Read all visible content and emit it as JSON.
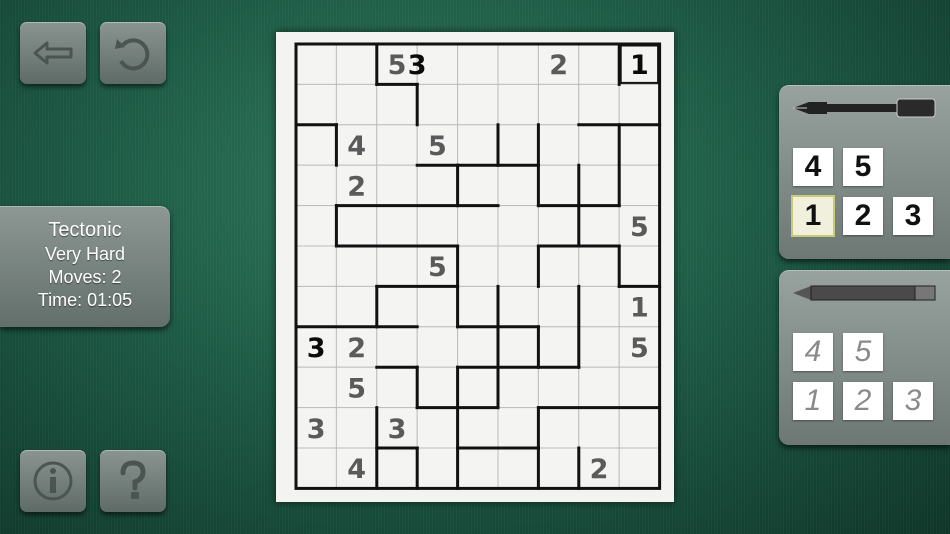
{
  "game": {
    "name": "Tectonic",
    "difficulty": "Very Hard",
    "moves": "Moves: 2",
    "time": "Time: 01:05"
  },
  "toolbar": {
    "back_icon": "back-arrow-icon",
    "undo_icon": "undo-icon",
    "info_icon": "info-icon",
    "help_icon": "help-question-icon"
  },
  "pen_keys": [
    "4",
    "5",
    "1",
    "2",
    "3"
  ],
  "pen_selected": "1",
  "pencil_keys": [
    "4",
    "5",
    "1",
    "2",
    "3"
  ],
  "board": {
    "cols": 9,
    "rows": 11,
    "givens": [
      {
        "r": 0,
        "c": 2,
        "v": "5"
      },
      {
        "r": 0,
        "c": 6,
        "v": "2"
      },
      {
        "r": 2,
        "c": 1,
        "v": "4"
      },
      {
        "r": 2,
        "c": 3,
        "v": "5"
      },
      {
        "r": 3,
        "c": 1,
        "v": "2"
      },
      {
        "r": 4,
        "c": 8,
        "v": "5"
      },
      {
        "r": 5,
        "c": 3,
        "v": "5"
      },
      {
        "r": 6,
        "c": 8,
        "v": "1"
      },
      {
        "r": 7,
        "c": 1,
        "v": "2"
      },
      {
        "r": 7,
        "c": 8,
        "v": "5"
      },
      {
        "r": 8,
        "c": 1,
        "v": "5"
      },
      {
        "r": 9,
        "c": 0,
        "v": "3"
      },
      {
        "r": 9,
        "c": 2,
        "v": "3"
      },
      {
        "r": 10,
        "c": 1,
        "v": "4"
      },
      {
        "r": 10,
        "c": 7,
        "v": "2"
      }
    ],
    "entries": [
      {
        "r": 0,
        "c": 2,
        "v": "3",
        "shift": 1
      },
      {
        "r": 0,
        "c": 8,
        "v": "1"
      },
      {
        "r": 7,
        "c": 0,
        "v": "3"
      }
    ]
  }
}
